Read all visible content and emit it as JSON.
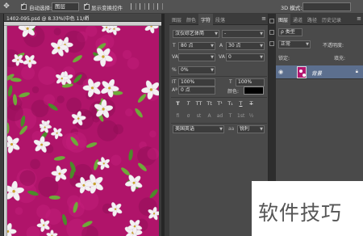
{
  "options_bar": {
    "auto_select_label": "自动选择:",
    "auto_select_value": "图层",
    "show_transform_label": "显示变换控件",
    "mode_label": "3D 模式:"
  },
  "document": {
    "tab_title": "1402-095.psd @ 8.33%(中色 11/8)",
    "close": "×"
  },
  "character_panel": {
    "tabs": [
      "图层",
      "颜色",
      "字符",
      "段落"
    ],
    "font_family": "汉仪综艺体简",
    "font_style": "-",
    "font_size": "80 点",
    "leading": "30 点",
    "kerning": "",
    "tracking": "0",
    "tsume": "0%",
    "vertical_scale": "100%",
    "horizontal_scale": "100%",
    "baseline_shift": "0 点",
    "color_label": "颜色:",
    "style_buttons": [
      "T",
      "T",
      "TT",
      "Tt",
      "T¹",
      "T₁",
      "T",
      "T"
    ],
    "opentype_buttons": [
      "fi",
      "σ",
      "st",
      "A",
      "ad",
      "T",
      "1st",
      "½"
    ],
    "language": "美国英语",
    "antialias": "锐利",
    "aa_prefix": "aa"
  },
  "layers_panel": {
    "tabs": [
      "图层",
      "通道",
      "路径",
      "历史记录"
    ],
    "filter_label": "ρ 类型",
    "blend_mode": "正常",
    "opacity_label": "不透明度:",
    "lock_label": "锁定:",
    "fill_label": "填充:",
    "layer_name": "背景",
    "lock_icon": "lock-icon"
  },
  "watermark": {
    "text": "软件技巧"
  },
  "colors": {
    "canvas": "#b0146a",
    "layer_selected": "#5c6f8e",
    "panel_bg": "#4a4a4a"
  }
}
